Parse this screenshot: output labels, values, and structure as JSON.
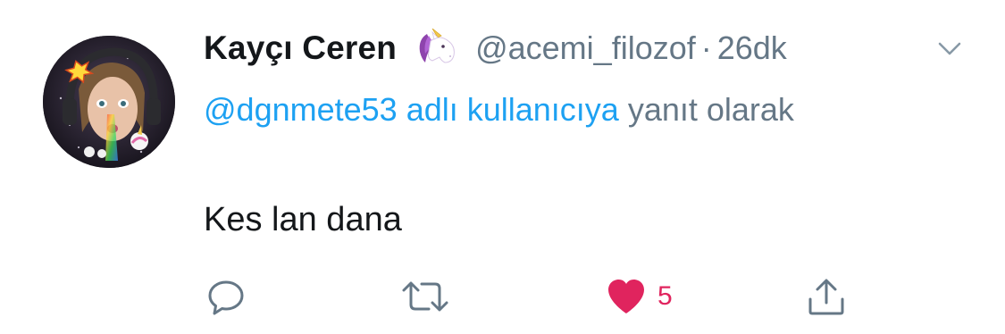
{
  "tweet": {
    "author": {
      "display_name": "Kayçı Ceren",
      "emoji": "🦄",
      "handle": "@acemi_filozof",
      "avatar_icon": "avatar-photo"
    },
    "separator": "·",
    "time": "26dk",
    "reply_context": {
      "mention": "@dgnmete53 adlı kullanıcıya",
      "suffix": " yanıt olarak"
    },
    "text": "Kes lan dana",
    "actions": {
      "reply_icon": "reply-icon",
      "retweet_icon": "retweet-icon",
      "like_icon": "heart-icon",
      "like_count": "5",
      "share_icon": "share-icon"
    }
  },
  "colors": {
    "text": "#14171a",
    "secondary": "#657786",
    "link": "#1da1f2",
    "like": "#e0245e"
  }
}
